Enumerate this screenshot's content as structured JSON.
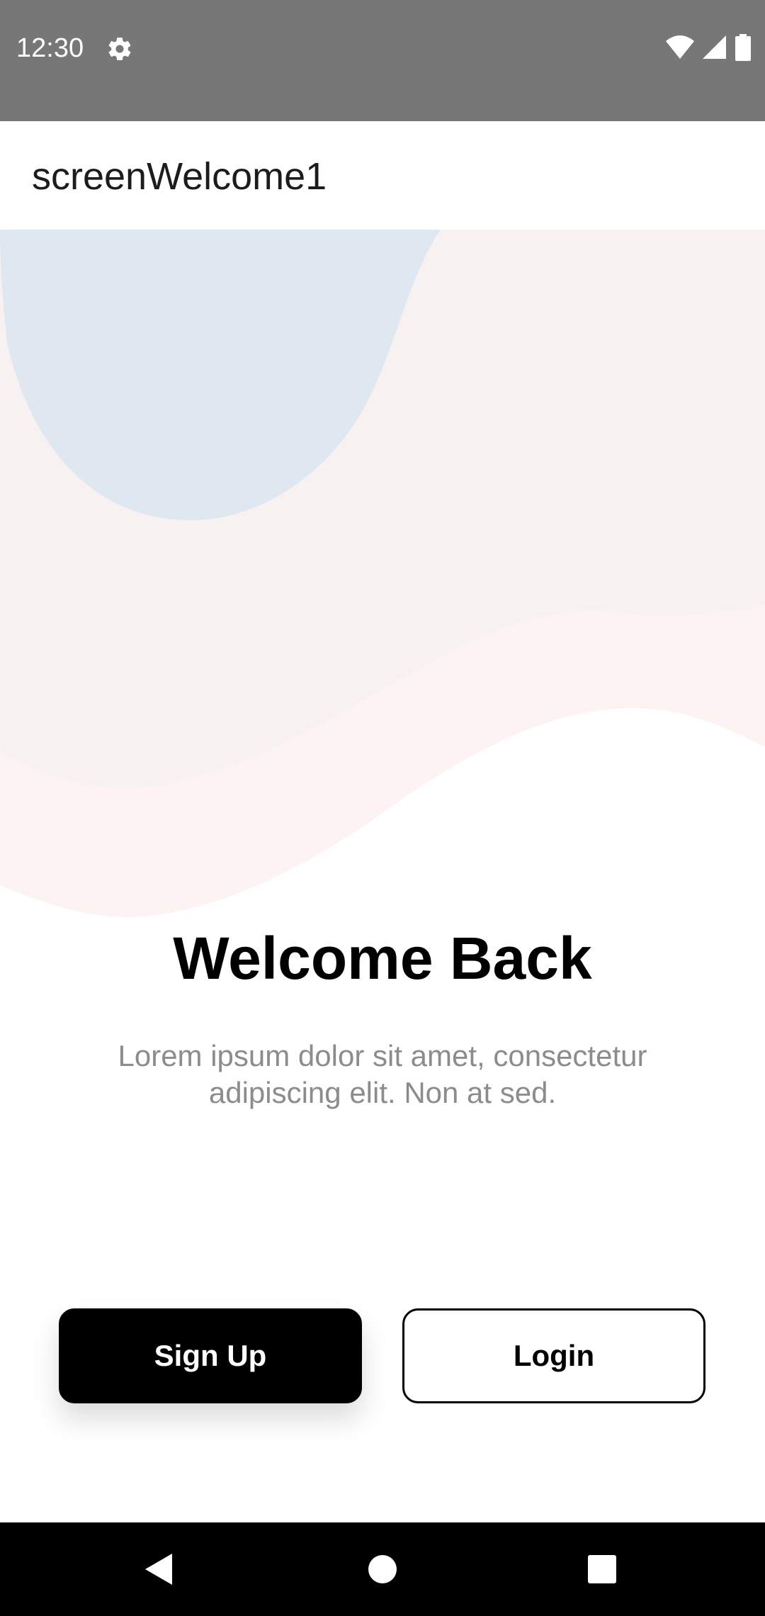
{
  "status_bar": {
    "time": "12:30",
    "icons": [
      "gear-icon",
      "wifi-icon",
      "cell-signal-icon",
      "battery-icon"
    ]
  },
  "app_bar": {
    "title": "screenWelcome1"
  },
  "welcome": {
    "title": "Welcome Back",
    "subtitle": "Lorem ipsum dolor sit amet, consectetur adipiscing elit. Non at sed."
  },
  "buttons": {
    "signup_label": "Sign Up",
    "login_label": "Login"
  },
  "nav_bar": {
    "icons": [
      "back-icon",
      "home-icon",
      "recents-icon"
    ]
  },
  "colors": {
    "status_bar": "#777777",
    "hero_background": "#f7f1f1",
    "hero_blob": "#dfe7f0",
    "hero_wave": "#fdf3f3",
    "primary_button": "#000000",
    "subtitle_text": "#8c8c8c"
  }
}
